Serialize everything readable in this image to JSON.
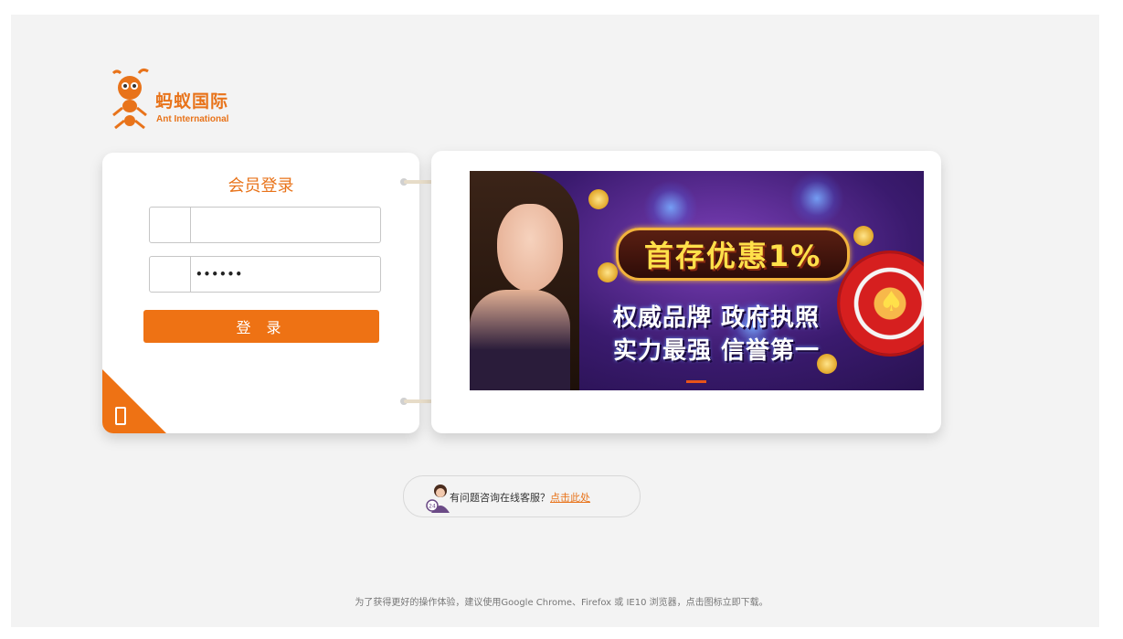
{
  "brand": {
    "name_cn": "蚂蚁国际",
    "name_en": "Ant International",
    "accent_color": "#ee7214"
  },
  "login": {
    "title": "会员登录",
    "username": {
      "value": "",
      "placeholder": "",
      "icon": "user-icon"
    },
    "password": {
      "value": "••••••",
      "placeholder": "",
      "icon": "lock-icon"
    },
    "submit_label": "登 录",
    "mobile_icon": "mobile-phone-icon"
  },
  "banner": {
    "headline": "首存优惠1%",
    "line1": "权威品牌 政府执照",
    "line2": "实力最强 信誉第一",
    "carousel_active_index": 0
  },
  "help": {
    "text": "有问题咨询在线客服？",
    "link": "点击此处",
    "avatar_badge": "24"
  },
  "footer": {
    "note": "为了获得更好的操作体验，建议使用Google Chrome、Firefox 或 IE10 浏览器，点击图标立即下载。"
  }
}
